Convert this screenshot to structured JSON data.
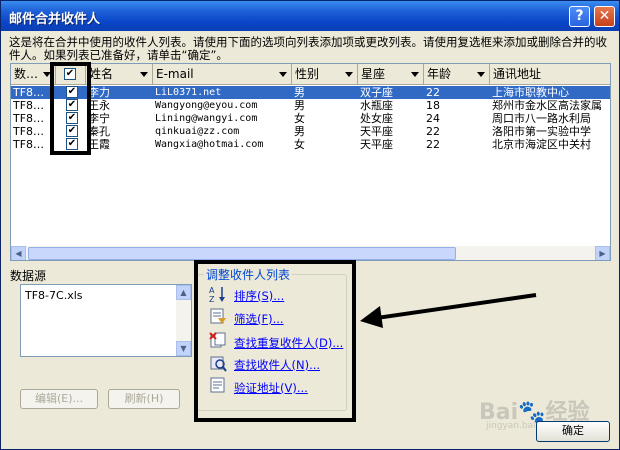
{
  "window": {
    "title": "邮件合并收件人",
    "help_glyph": "?",
    "close_glyph": "✕"
  },
  "description": "这是将在合并中使用的收件人列表。请使用下面的选项向列表添加项或更改列表。请使用复选框来添加或删除合并的收件人。如果列表已准备好，请单击“确定”。",
  "table": {
    "columns": [
      "数…",
      "",
      "姓名",
      "E-mail",
      "性别",
      "星座",
      "年龄",
      "通讯地址"
    ],
    "rows": [
      {
        "src": "TF8…",
        "checked": true,
        "name": "李力",
        "email": "LiL0371.net",
        "gender": "男",
        "sign": "双子座",
        "age": "22",
        "address": "上海市职教中心",
        "selected": true
      },
      {
        "src": "TF8…",
        "checked": true,
        "name": "王永",
        "email": "Wangyong@eyou.com",
        "gender": "男",
        "sign": "水瓶座",
        "age": "18",
        "address": "郑州市金水区高法家属",
        "selected": false
      },
      {
        "src": "TF8…",
        "checked": true,
        "name": "李宁",
        "email": "Lining@wangyi.com",
        "gender": "女",
        "sign": "处女座",
        "age": "24",
        "address": "周口市八一路水利局",
        "selected": false
      },
      {
        "src": "TF8…",
        "checked": true,
        "name": "秦孔",
        "email": "qinkuai@zz.com",
        "gender": "男",
        "sign": "天平座",
        "age": "22",
        "address": "洛阳市第一实验中学",
        "selected": false
      },
      {
        "src": "TF8…",
        "checked": true,
        "name": "王霞",
        "email": "Wangxia@hotmai.com",
        "gender": "女",
        "sign": "天平座",
        "age": "22",
        "address": "北京市海淀区中关村",
        "selected": false
      }
    ]
  },
  "datasource": {
    "label": "数据源",
    "items": [
      "TF8-7C.xls"
    ],
    "edit_button": "编辑(E)...",
    "refresh_button": "刷新(H)"
  },
  "adjust": {
    "title": "调整收件人列表",
    "links": [
      {
        "label": "排序(S)...",
        "icon": "sort-az-icon"
      },
      {
        "label": "筛选(F)...",
        "icon": "filter-icon"
      },
      {
        "label": "查找重复收件人(D)...",
        "icon": "find-duplicates-icon"
      },
      {
        "label": "查找收件人(N)...",
        "icon": "find-recipient-icon"
      },
      {
        "label": "验证地址(V)...",
        "icon": "validate-address-icon"
      }
    ]
  },
  "ok_button": "确定",
  "watermark": {
    "brand": "Bai🐾经验",
    "url": "jingyan.baidu.com"
  },
  "colors": {
    "titlebar": "#0a46c8",
    "selection": "#316ac5",
    "dialog_bg": "#ece9d8",
    "link": "#0000ff"
  }
}
